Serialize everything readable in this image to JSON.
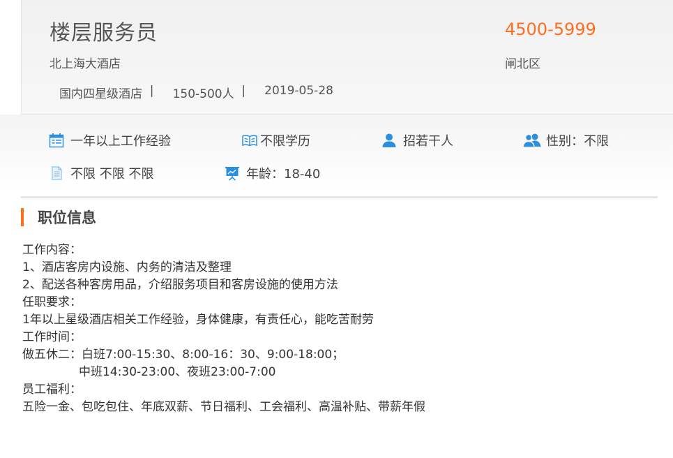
{
  "job": {
    "title": "楼层服务员",
    "salary": "4500-5999",
    "company": "北上海大酒店",
    "district": "闸北区",
    "meta": {
      "company_type": "国内四星级酒店",
      "separator1": "  |     ",
      "company_size": "150-500人",
      "separator2": "  |     ",
      "date": "2019-05-28"
    }
  },
  "requirements": {
    "experience": "一年以上工作经验",
    "education": "不限学历",
    "headcount": "招若干人",
    "gender": "性别：不限",
    "other": "不限 不限 不限",
    "age": "年龄：18-40"
  },
  "icons": {
    "experience": "calendar-icon",
    "education": "book-icon",
    "headcount": "person-icon",
    "gender": "people-icon",
    "other": "document-icon",
    "age": "presentation-icon"
  },
  "colors": {
    "accent": "#ff6e1f",
    "icon_blue": "#2b8fe0"
  },
  "section": {
    "title": "职位信息"
  },
  "description": {
    "lines": [
      "工作内容：",
      "1、酒店客房内设施、内务的清洁及整理",
      "2、配送各种客房用品，介绍服务项目和客房设施的使用方法",
      "任职要求：",
      "1年以上星级酒店相关工作经验，身体健康，有责任心，能吃苦耐劳",
      "工作时间：",
      "做五休二：白班7:00-15:30、8:00-16：30、9:00-18:00；",
      "               中班14:30-23:00、夜班23:00-7:00",
      "员工福利：",
      "五险一金、包吃包住、年底双薪、节日福利、工会福利、高温补贴、带薪年假"
    ]
  }
}
